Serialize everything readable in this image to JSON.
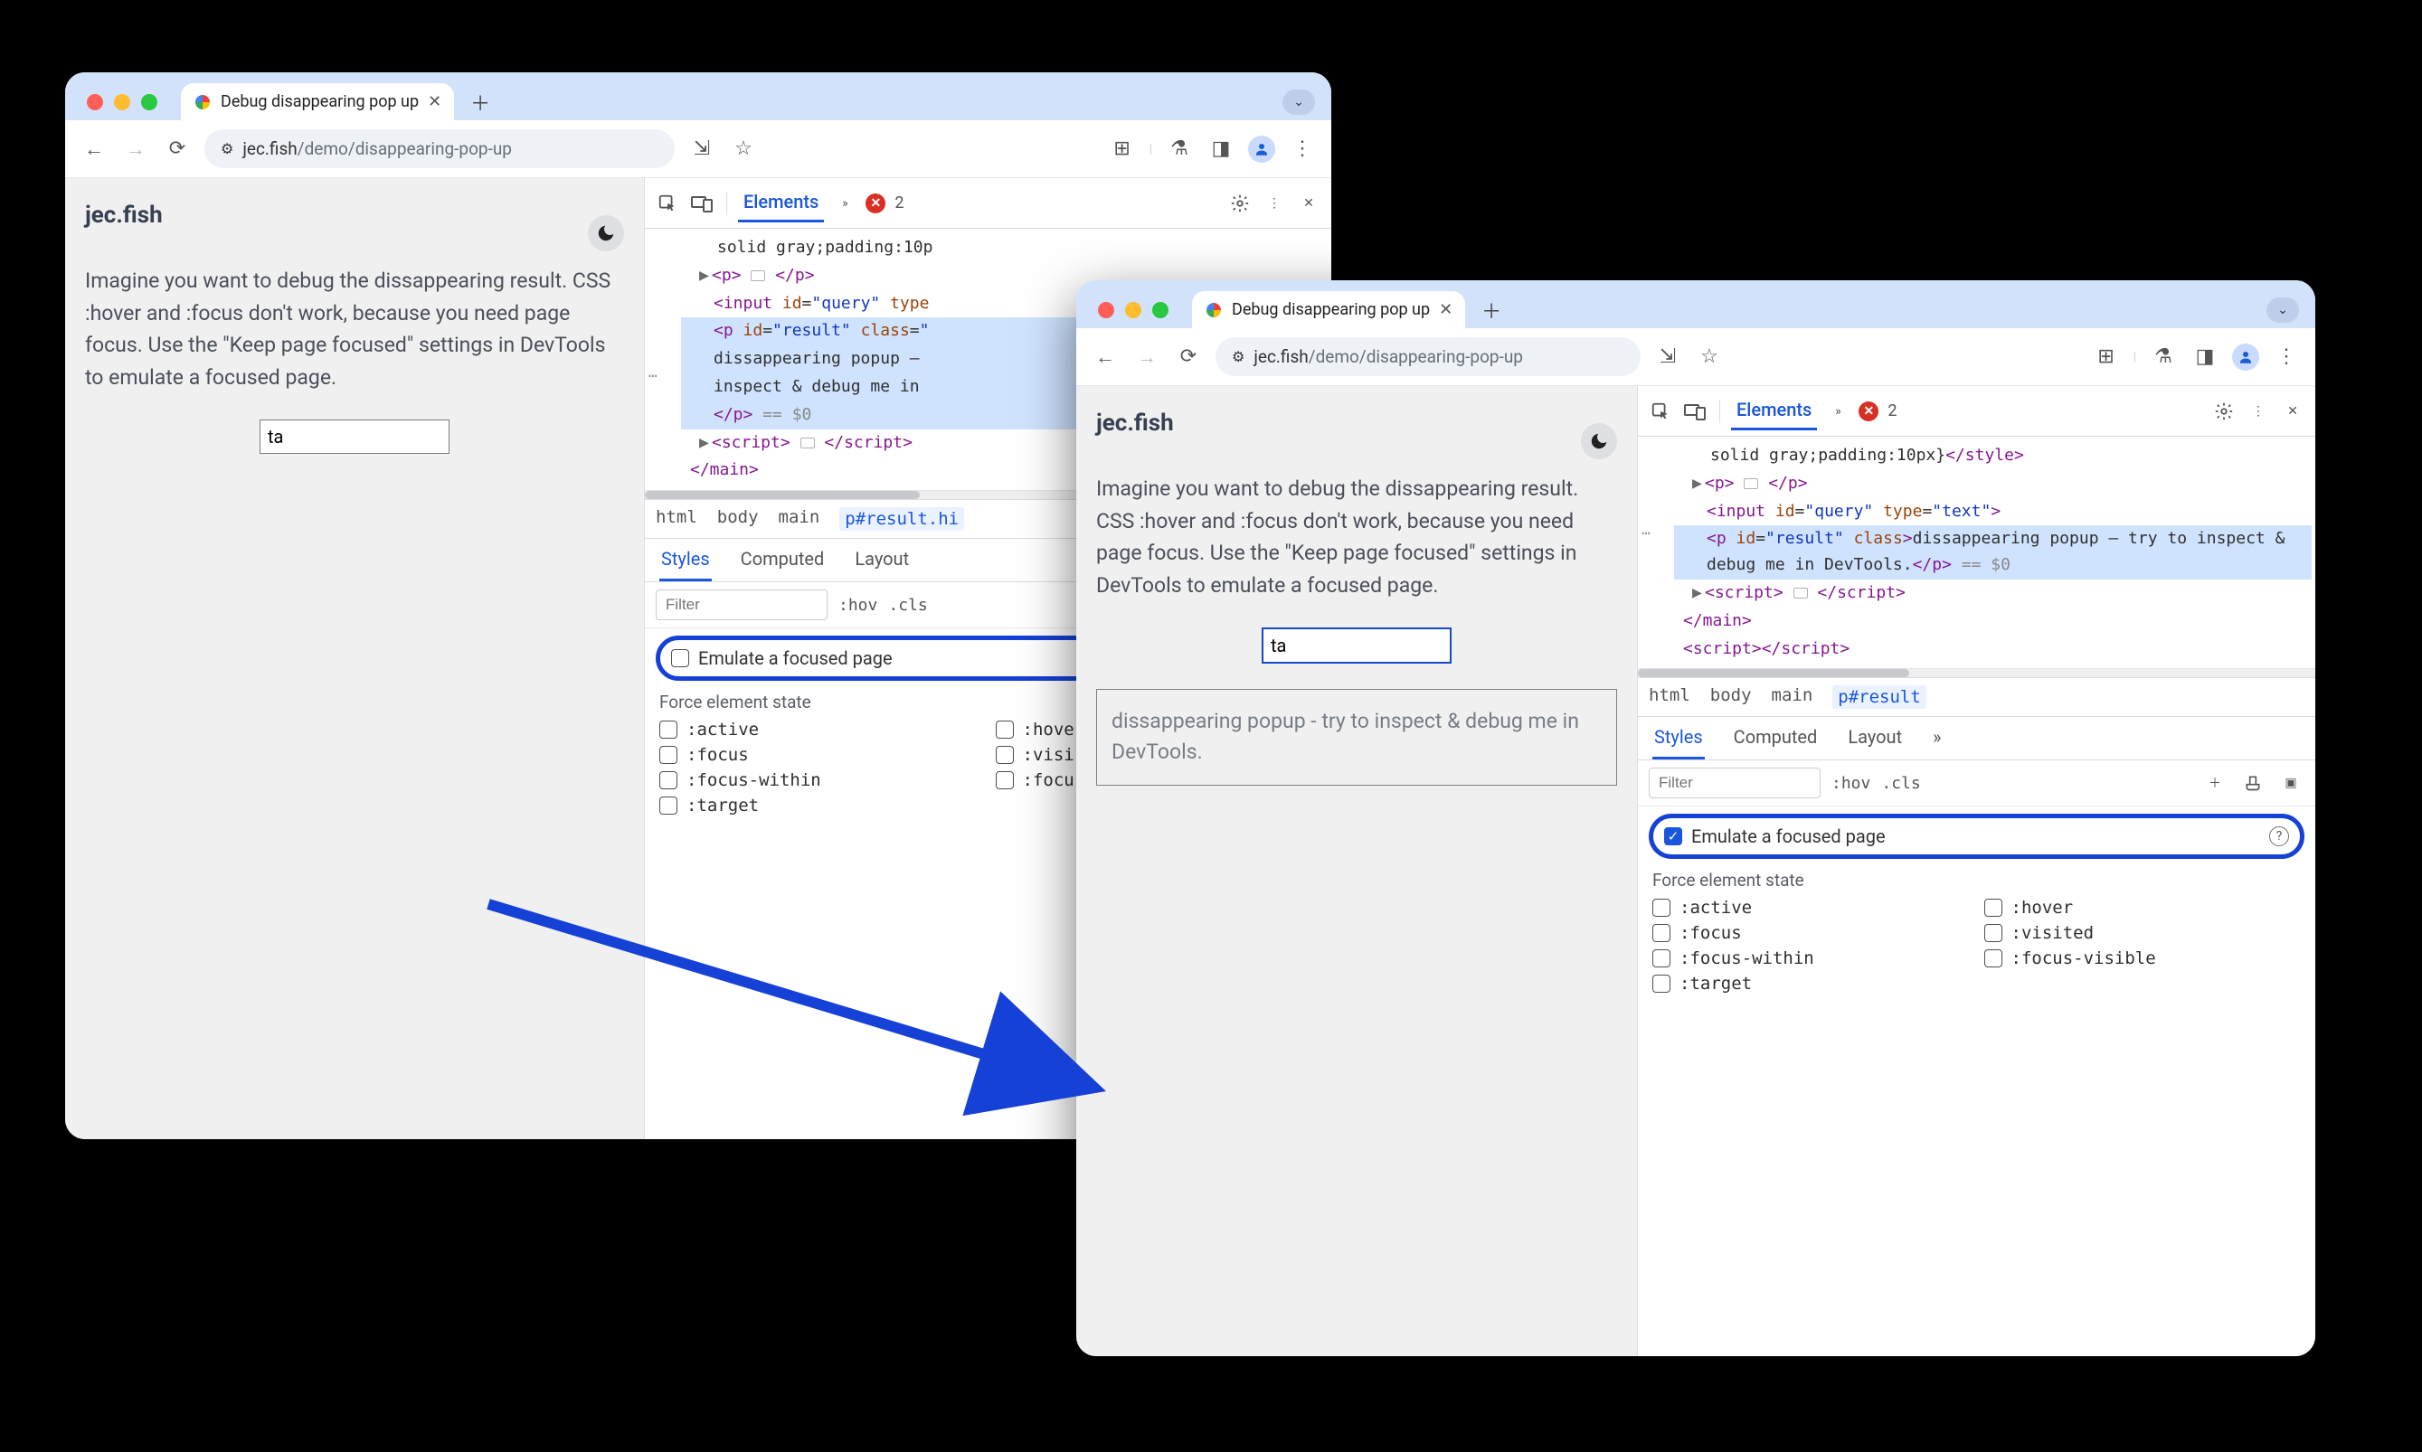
{
  "common": {
    "tab_title": "Debug disappearing pop up",
    "url_domain": "jec.fish",
    "url_path": "/demo/disappearing-pop-up",
    "site_title": "jec.fish",
    "body_text": "Imagine you want to debug the dissappearing result. CSS :hover and :focus don't work, because you need page focus. Use the \"Keep page focused\" settings in DevTools to emulate a focused page.",
    "input_value": "ta",
    "popup_text": "dissappearing popup - try to inspect & debug me in DevTools."
  },
  "devtools": {
    "tab_elements": "Elements",
    "error_count": "2",
    "crumb_html": "html",
    "crumb_body": "body",
    "crumb_main": "main",
    "crumb_sel_left": "p#result.hi",
    "crumb_sel_right": "p#result",
    "styles_tab_styles": "Styles",
    "styles_tab_computed": "Computed",
    "styles_tab_layout": "Layout",
    "filter_placeholder": "Filter",
    "hov": ":hov",
    "cls": ".cls",
    "emulate_label": "Emulate a focused page",
    "force_label": "Force element state",
    "states_left": [
      ":active",
      ":focus",
      ":focus-within",
      ":target"
    ],
    "states_right_full": [
      ":hover",
      ":visited",
      ":focus-visible"
    ],
    "states_right_clipped": [
      ":hove",
      ":visi",
      ":focu"
    ],
    "dom_left": {
      "l1": "solid gray;padding:10p",
      "l2a": "<p>",
      "l2b": "</p>",
      "l3": "<input id=\"query\" type",
      "l4": "<p id=\"result\" class=\"",
      "l5": "dissappearing popup –",
      "l6": "inspect & debug me in",
      "l7": "</p>",
      "l7b": "== $0",
      "l8a": "<script>",
      "l8b": "</script>",
      "l9": "</main>"
    },
    "dom_right": {
      "l1": "solid gray;padding:10px}",
      "l1b": "</style>",
      "l2a": "<p>",
      "l2b": "</p>",
      "l3": "<input id=\"query\" type=\"text\">",
      "l4": "<p id=\"result\" class>",
      "l5": "dissappearing popup – try to inspect & debug me in DevTools.",
      "l6": "</p>",
      "l6b": "== $0",
      "l7a": "<script>",
      "l7b": "</script>",
      "l8": "</main>",
      "l9a": "<script>",
      "l9b": "</script>"
    }
  }
}
